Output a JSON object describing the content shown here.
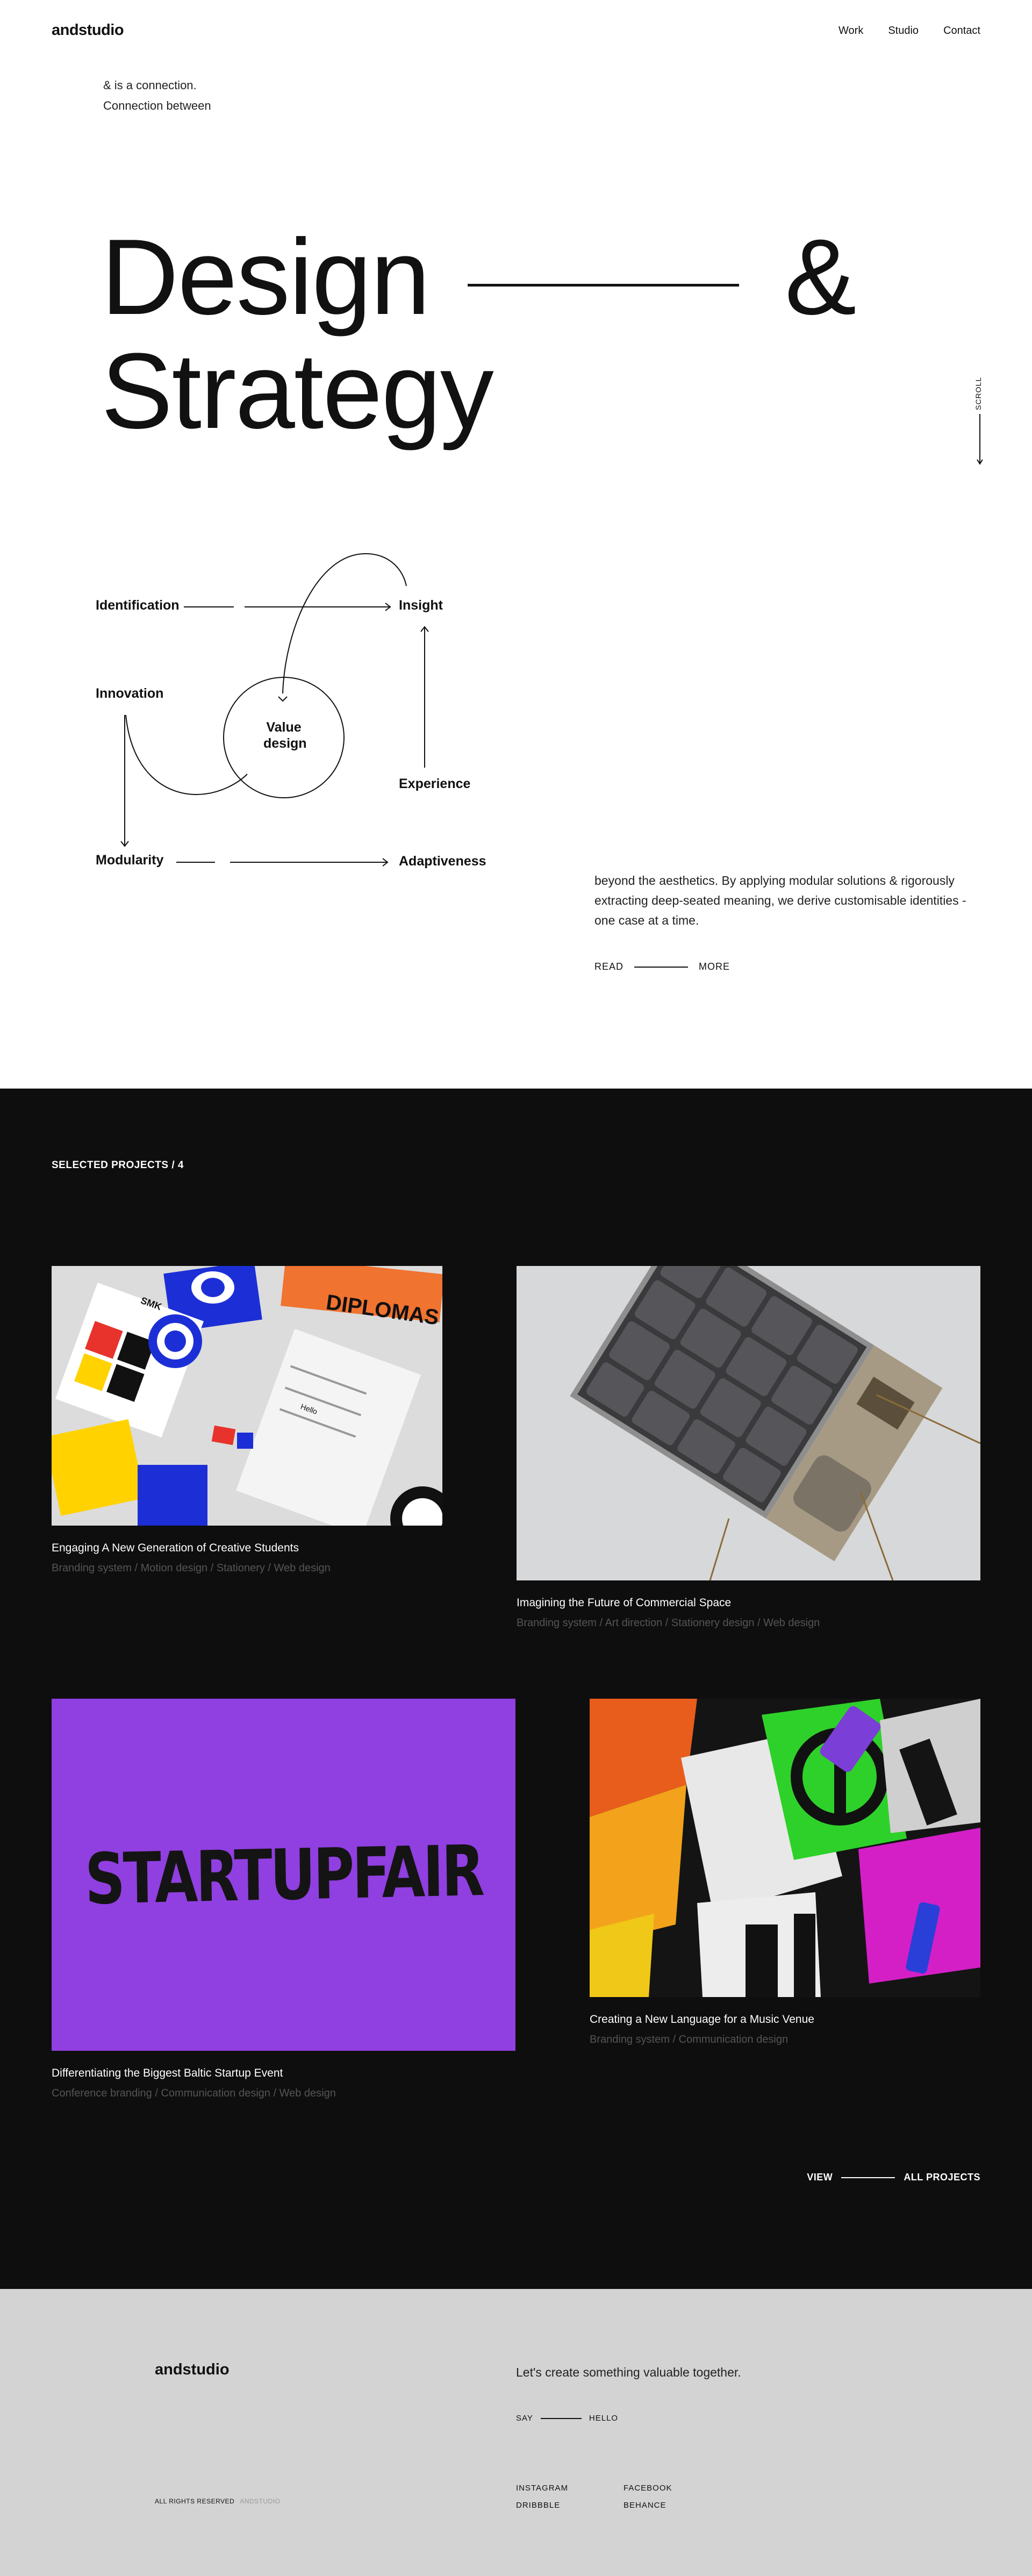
{
  "header": {
    "logo": "andstudio",
    "nav": [
      "Work",
      "Studio",
      "Contact"
    ]
  },
  "hero": {
    "intro_line1": "& is a connection.",
    "intro_line2": "Connection between",
    "headline_line1": "Design",
    "headline_amp": "&",
    "headline_line2": "Strategy",
    "scroll_label": "SCROLL"
  },
  "diagram": {
    "identification": "Identification",
    "insight": "Insight",
    "innovation": "Innovation",
    "value_line1": "Value",
    "value_line2": "design",
    "experience": "Experience",
    "modularity": "Modularity",
    "adaptiveness": "Adaptiveness"
  },
  "about": {
    "text": "beyond the aesthetics. By applying modular solutions & rigorously extracting deep-seated meaning, we derive customisable identities - one case at a time.",
    "read": "READ",
    "more": "MORE"
  },
  "projects": {
    "label": "SELECTED PROJECTS / 4",
    "items": [
      {
        "title": "Engaging A New Generation of Creative Students",
        "tags": "Branding system / Motion design / Stationery / Web design",
        "image_text_1": "SMK",
        "image_text_2": "DIPLOMAS",
        "image_text_3": "Hello"
      },
      {
        "title": "Imagining the Future of Commercial Space",
        "tags": "Branding system / Art direction / Stationery design / Web design"
      },
      {
        "title": "Differentiating the Biggest Baltic Startup Event",
        "tags": "Conference branding / Communication design / Web design",
        "image_text": "STARTUPFAIR"
      },
      {
        "title": "Creating a New Language for a Music Venue",
        "tags": "Branding system / Communication design"
      }
    ],
    "view": "VIEW",
    "all": "ALL PROJECTS"
  },
  "footer": {
    "logo": "andstudio",
    "cta": "Let's create something valuable together.",
    "say": "SAY",
    "hello": "HELLO",
    "rights": "ALL RIGHTS RESERVED",
    "rights_muted": "ANDSTUDIO",
    "social": [
      "INSTAGRAM",
      "DRIBBBLE",
      "FACEBOOK",
      "BEHANCE"
    ]
  },
  "colors": {
    "dark": "#0e0e0e",
    "purple": "#903fe0",
    "footer_bg": "#d3d3d3",
    "muted": "#555555"
  }
}
